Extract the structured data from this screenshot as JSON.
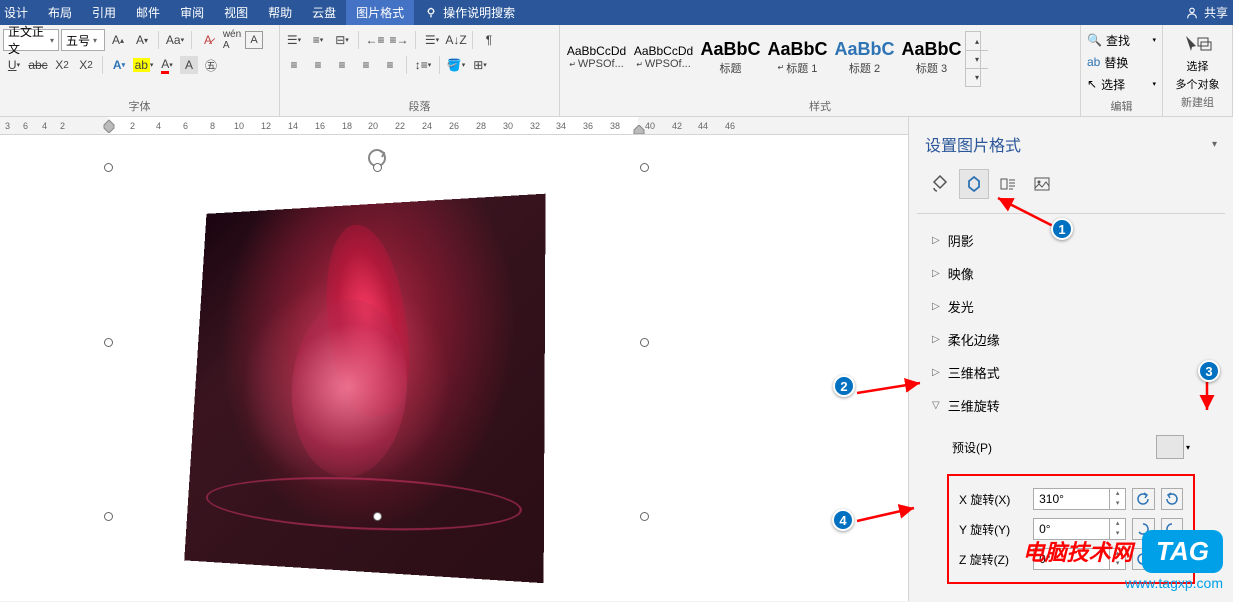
{
  "tabs": {
    "design": "设计",
    "layout": "布局",
    "references": "引用",
    "mailings": "邮件",
    "review": "审阅",
    "view": "视图",
    "help": "帮助",
    "cloud": "云盘",
    "picfmt": "图片格式",
    "tellme": "操作说明搜索"
  },
  "share_label": "共享",
  "font": {
    "style": "正文正文",
    "size": "五号",
    "group_label": "字体"
  },
  "para": {
    "group_label": "段落"
  },
  "styles": {
    "group_label": "样式",
    "items": [
      {
        "preview": "AaBbCcDd",
        "name": "WPSOf...",
        "cls": ""
      },
      {
        "preview": "AaBbCcDd",
        "name": "WPSOf...",
        "cls": ""
      },
      {
        "preview": "AaBbC",
        "name": "标题",
        "cls": "big"
      },
      {
        "preview": "AaBbC",
        "name": "标题 1",
        "cls": "big"
      },
      {
        "preview": "AaBbC",
        "name": "标题 2",
        "cls": "big blue"
      },
      {
        "preview": "AaBbC",
        "name": "标题 3",
        "cls": "big"
      }
    ]
  },
  "editing": {
    "group_label": "编辑",
    "find": "查找",
    "replace": "替换",
    "select": "选择"
  },
  "select_group": {
    "select": "选择",
    "multi": "多个对象",
    "newgroup": "新建组"
  },
  "ruler_marks": [
    "3",
    "6",
    "4",
    "2",
    "",
    "2",
    "4",
    "6",
    "8",
    "10",
    "12",
    "14",
    "16",
    "18",
    "20",
    "22",
    "24",
    "26",
    "28",
    "30",
    "32",
    "34",
    "36",
    "38",
    "40",
    "42",
    "44",
    "46"
  ],
  "pane": {
    "title": "设置图片格式",
    "sections": {
      "shadow": "阴影",
      "reflection": "映像",
      "glow": "发光",
      "soft": "柔化边缘",
      "format3d": "三维格式",
      "rotate3d": "三维旋转"
    },
    "preset": "预设(P)",
    "rot": {
      "x_label": "X 旋转(X)",
      "y_label": "Y 旋转(Y)",
      "z_label": "Z 旋转(Z)",
      "x_val": "310°",
      "y_val": "0°",
      "z_val": "0°"
    }
  },
  "watermark": {
    "text": "电脑技术网",
    "tag": "TAG",
    "url": "www.tagxp.com"
  }
}
